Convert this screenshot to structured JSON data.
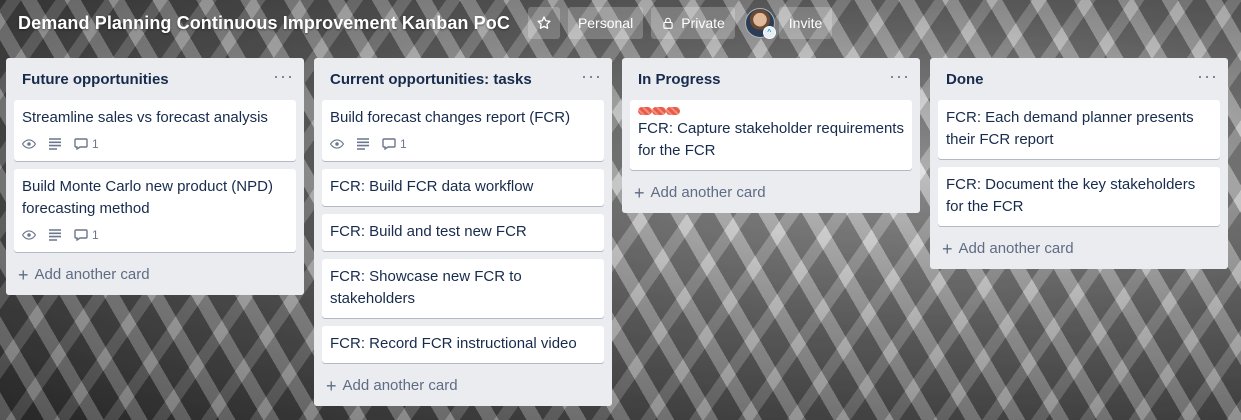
{
  "header": {
    "title": "Demand Planning Continuous Improvement Kanban PoC",
    "visibility_team": "Personal",
    "visibility_privacy": "Private",
    "invite_label": "Invite",
    "icons": {
      "star": "star-icon",
      "lock": "lock-icon"
    }
  },
  "lists": [
    {
      "title": "Future opportunities",
      "menu": "···",
      "cards": [
        {
          "title": "Streamline sales vs forecast analysis",
          "comments": "1"
        },
        {
          "title": "Build Monte Carlo new product (NPD) forecasting method",
          "comments": "1"
        }
      ],
      "add_label": "Add another card"
    },
    {
      "title": "Current opportunities: tasks",
      "menu": "···",
      "cards": [
        {
          "title": "Build forecast changes report (FCR)",
          "comments": "1"
        },
        {
          "title": "FCR: Build FCR data workflow"
        },
        {
          "title": "FCR: Build and test new FCR"
        },
        {
          "title": "FCR: Showcase new FCR to stakeholders"
        },
        {
          "title": "FCR: Record FCR instructional video"
        }
      ],
      "add_label": "Add another card"
    },
    {
      "title": "In Progress",
      "menu": "···",
      "cards": [
        {
          "title": "FCR: Capture stakeholder requirements for the FCR",
          "label_color": "#eb5a46"
        }
      ],
      "add_label": "Add another card"
    },
    {
      "title": "Done",
      "menu": "···",
      "cards": [
        {
          "title": "FCR: Each demand planner presents their FCR report"
        },
        {
          "title": "FCR: Document the key stakeholders for the FCR"
        }
      ],
      "add_label": "Add another card"
    }
  ]
}
